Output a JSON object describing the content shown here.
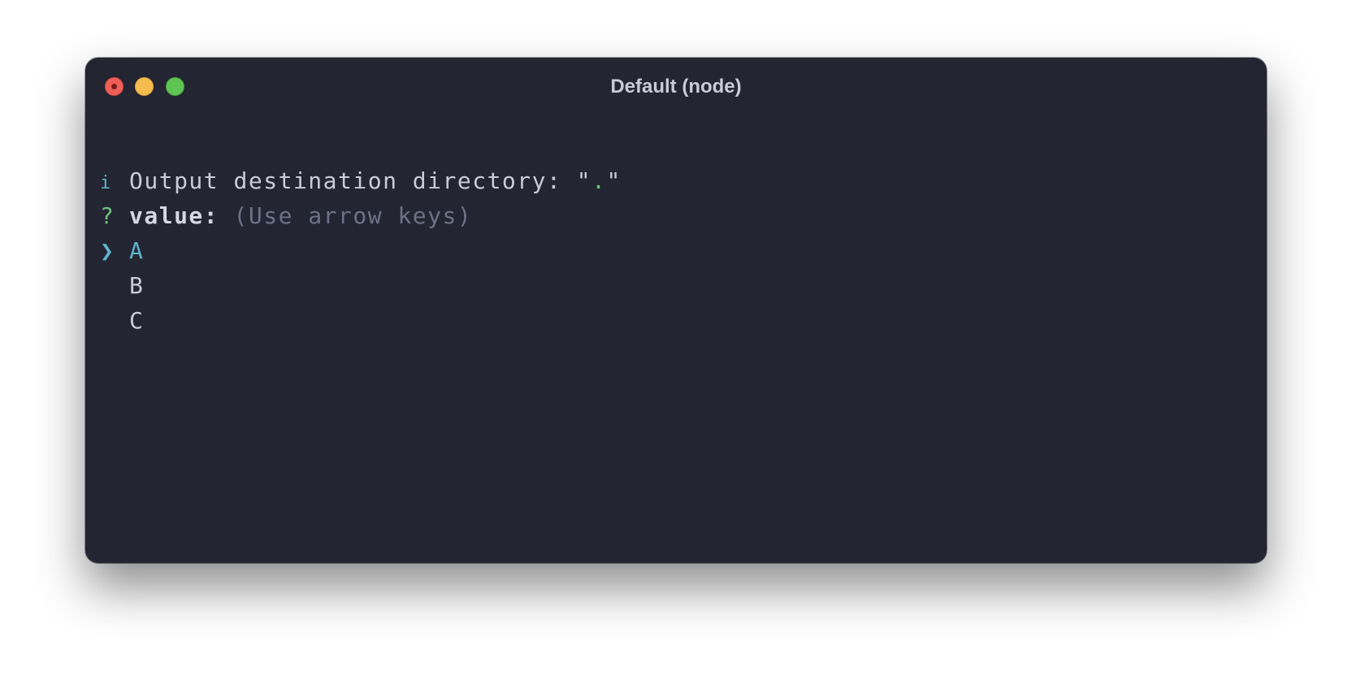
{
  "window": {
    "title": "Default (node)"
  },
  "terminal": {
    "info_line": {
      "symbol": "i",
      "text": "Output destination directory: ",
      "quote_open": "\"",
      "value": ".",
      "quote_close": "\""
    },
    "prompt_line": {
      "symbol": "?",
      "label": "value:",
      "hint": "(Use arrow keys)"
    },
    "options": [
      {
        "pointer": "❯",
        "label": "A",
        "selected": true
      },
      {
        "pointer": "",
        "label": "B",
        "selected": false
      },
      {
        "pointer": "",
        "label": "C",
        "selected": false
      }
    ]
  },
  "colors": {
    "background": "#232533",
    "accent_cyan": "#5fb4c9",
    "accent_green": "#6fbf7a",
    "text": "#c9cbd8",
    "hint": "#6e7186"
  }
}
